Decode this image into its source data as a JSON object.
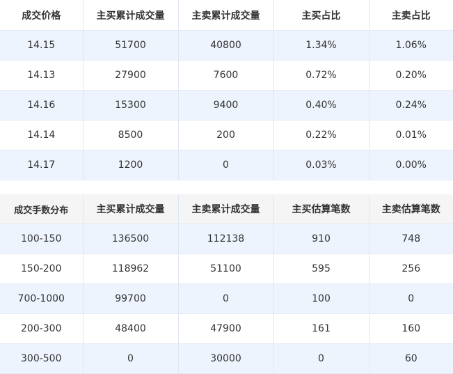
{
  "price_table": {
    "headers": [
      "成交价格",
      "主买累计成交量",
      "主卖累计成交量",
      "主买占比",
      "主卖占比"
    ],
    "rows": [
      [
        "14.15",
        "51700",
        "40800",
        "1.34%",
        "1.06%"
      ],
      [
        "14.13",
        "27900",
        "7600",
        "0.72%",
        "0.20%"
      ],
      [
        "14.16",
        "15300",
        "9400",
        "0.40%",
        "0.24%"
      ],
      [
        "14.14",
        "8500",
        "200",
        "0.22%",
        "0.01%"
      ],
      [
        "14.17",
        "1200",
        "0",
        "0.03%",
        "0.00%"
      ]
    ]
  },
  "lot_table": {
    "headers": [
      "成交手数分布",
      "主买累计成交量",
      "主卖累计成交量",
      "主买估算笔数",
      "主卖估算笔数"
    ],
    "rows": [
      [
        "100-150",
        "136500",
        "112138",
        "910",
        "748"
      ],
      [
        "150-200",
        "118962",
        "51100",
        "595",
        "256"
      ],
      [
        "700-1000",
        "99700",
        "0",
        "100",
        "0"
      ],
      [
        "200-300",
        "48400",
        "47900",
        "161",
        "160"
      ],
      [
        "300-500",
        "0",
        "30000",
        "0",
        "60"
      ]
    ]
  },
  "colors": {
    "buy_highlight": "#e02020",
    "sell_highlight": "#0e9a0e",
    "alt_row": "#eef4fd"
  }
}
